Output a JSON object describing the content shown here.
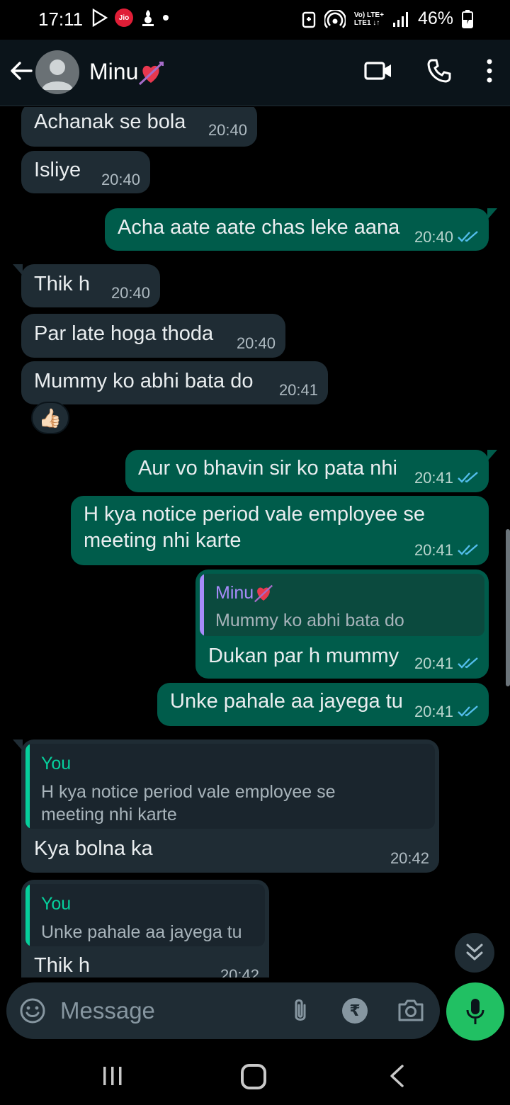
{
  "status_bar": {
    "time": "17:11",
    "carrier_badge": "Jio",
    "lte_top": "Vo) LTE+",
    "lte_bottom": "LTE1 ↓↑",
    "battery": "46%"
  },
  "header": {
    "contact_name": "Minu",
    "contact_emoji": "heart-with-arrow",
    "icons": [
      "back-arrow-icon",
      "video-call-icon",
      "voice-call-icon",
      "more-options-icon"
    ]
  },
  "messages": [
    {
      "dir": "in",
      "text": "Achanak se bola",
      "time": "20:40"
    },
    {
      "dir": "in",
      "text": "Isliye",
      "time": "20:40"
    },
    {
      "dir": "out",
      "text": "Acha aate aate chas leke aana",
      "time": "20:40",
      "status": "read"
    },
    {
      "dir": "in",
      "text": "Thik h",
      "time": "20:40"
    },
    {
      "dir": "in",
      "text": "Par late hoga thoda",
      "time": "20:40"
    },
    {
      "dir": "in",
      "text": "Mummy ko abhi bata do",
      "time": "20:41",
      "reaction": "👍🏻"
    },
    {
      "dir": "out",
      "text": "Aur vo bhavin sir ko pata nhi",
      "time": "20:41",
      "status": "read"
    },
    {
      "dir": "out",
      "text_line1": "H kya notice period vale employee se",
      "text_line2": "meeting nhi karte",
      "time": "20:41",
      "status": "read"
    },
    {
      "dir": "out",
      "reply_to_name": "Minu",
      "reply_to_text": "Mummy ko abhi bata do",
      "text": "Dukan par h mummy",
      "time": "20:41",
      "status": "read"
    },
    {
      "dir": "out",
      "text": "Unke pahale aa jayega tu",
      "time": "20:41",
      "status": "read"
    },
    {
      "dir": "in",
      "reply_to_name": "You",
      "reply_to_line1": "H kya notice period vale employee se",
      "reply_to_line2": "meeting nhi karte",
      "text": "Kya bolna ka",
      "time": "20:42"
    },
    {
      "dir": "in",
      "reply_to_name": "You",
      "reply_to_text": "Unke pahale aa jayega tu",
      "text": "Thik h",
      "time": "20:42"
    }
  ],
  "composer": {
    "placeholder": "Message",
    "rupee_symbol": "₹"
  },
  "colors": {
    "incoming_bubble": "#1f2c34",
    "outgoing_bubble": "#005c4b",
    "accent_green": "#21c063",
    "read_ticks": "#53bdeb",
    "reply_you": "#06cf9c",
    "reply_contact": "#a78bfa"
  }
}
